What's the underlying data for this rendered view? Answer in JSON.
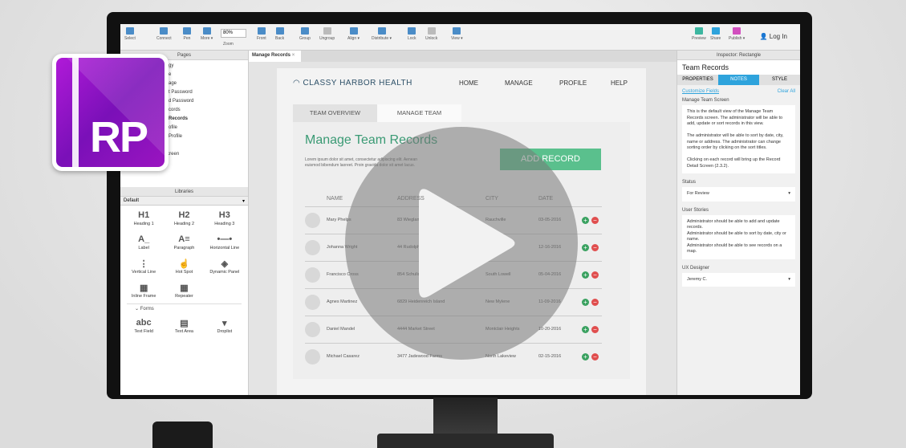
{
  "toolbar": {
    "items": [
      "Select",
      "Connect",
      "Pen",
      "More ▾",
      "Front",
      "Back",
      "Group",
      "Ungroup",
      "Align ▾",
      "Distribute ▾",
      "Lock",
      "Unlock",
      "View ▾"
    ],
    "zoom_value": "80%",
    "zoom_label": "Zoom",
    "right": [
      "Preview",
      "Share",
      "Publish ▾"
    ],
    "login": "Log In"
  },
  "logo": "RP",
  "pages": {
    "title": "Pages",
    "items": [
      "gy",
      "e",
      "age",
      "t Password",
      "d Password",
      "cords",
      "Records",
      "ofile",
      "Profile",
      "Home",
      "Home Screen"
    ]
  },
  "libraries": {
    "title": "Libraries",
    "selected": "Default",
    "items": [
      {
        "g": "H1",
        "l": "Heading 1"
      },
      {
        "g": "H2",
        "l": "Heading 2"
      },
      {
        "g": "H3",
        "l": "Heading 3"
      },
      {
        "g": "A_",
        "l": "Label"
      },
      {
        "g": "A≡",
        "l": "Paragraph"
      },
      {
        "g": "•—•",
        "l": "Horizontal Line"
      },
      {
        "g": "⋮",
        "l": "Vertical Line"
      },
      {
        "g": "☝",
        "l": "Hot Spot"
      },
      {
        "g": "◈",
        "l": "Dynamic Panel"
      },
      {
        "g": "▦",
        "l": "Inline Frame"
      },
      {
        "g": "▦",
        "l": "Repeater"
      }
    ],
    "section": "Forms",
    "forms": [
      {
        "g": "abc",
        "l": "Text Field"
      },
      {
        "g": "▤",
        "l": "Text Area"
      },
      {
        "g": "▾",
        "l": "Droplist"
      }
    ]
  },
  "doc_tab": "Manage Records",
  "site": {
    "brand": "CLASSY HARBOR HEALTH",
    "nav": [
      "HOME",
      "MANAGE",
      "PROFILE",
      "HELP"
    ],
    "tabs": [
      "TEAM OVERVIEW",
      "MANAGE TEAM"
    ],
    "title": "Manage Team Records",
    "lorem": "Lorem ipsum dolor sit amet, consectetur adipiscing elit. Aenean euismod bibendum laoreet. Proin gravida dolor sit amet lacus.",
    "add": "ADD RECORD",
    "columns": [
      "NAME",
      "ADDRESS",
      "CITY",
      "DATE"
    ],
    "rows": [
      [
        "Mary Phelps",
        "83 Wiegland Manor Apt 726",
        "Rauchville",
        "03-05-2016"
      ],
      [
        "Johanna Wright",
        "44 Rudolph Road Suite 204",
        "Howemouth",
        "12-16-2016"
      ],
      [
        "Francisco Cross",
        "854 Schulist Landing",
        "South Lowell",
        "05-04-2016"
      ],
      [
        "Agnes Martinez",
        "6829 Heidenreich Island",
        "New Mylene",
        "11-09-2016"
      ],
      [
        "Daniel Mandel",
        "4444 Market Street",
        "Montclair Heights",
        "10-20-2016"
      ],
      [
        "Michael Casarez",
        "3477 Jadewood Farms",
        "North Lakeview",
        "02-15-2016"
      ]
    ]
  },
  "inspector": {
    "header": "Inspector: Rectangle",
    "name": "Team Records",
    "tabs": [
      "PROPERTIES",
      "NOTES",
      "STYLE"
    ],
    "customize": "Customize Fields",
    "clear": "Clear All",
    "section": "Manage Team Screen",
    "notes": [
      "This is the default view of the Manage Team Records screen. The administrator will be able to add, update or sort records in this view.",
      "The administrator will be able to sort by date, city, name or address. The administrator can change sorting order by clicking on the sort titles.",
      "Clicking on each record will bring up the Record Detail Screen (2.3.2)."
    ],
    "status_label": "Status",
    "status": "For Review",
    "stories_label": "User Stories",
    "stories": [
      "Administrator should be able to add and update records.",
      "Administrator should be able to sort by date, city or name.",
      "Administrator should be able to see records on a map."
    ],
    "designer_label": "UX Designer",
    "designer": "Jeremy C."
  },
  "colors": {
    "accent": "#5ac08d",
    "notes_tab": "#2ea3dc",
    "logo": "#9a14c0"
  }
}
